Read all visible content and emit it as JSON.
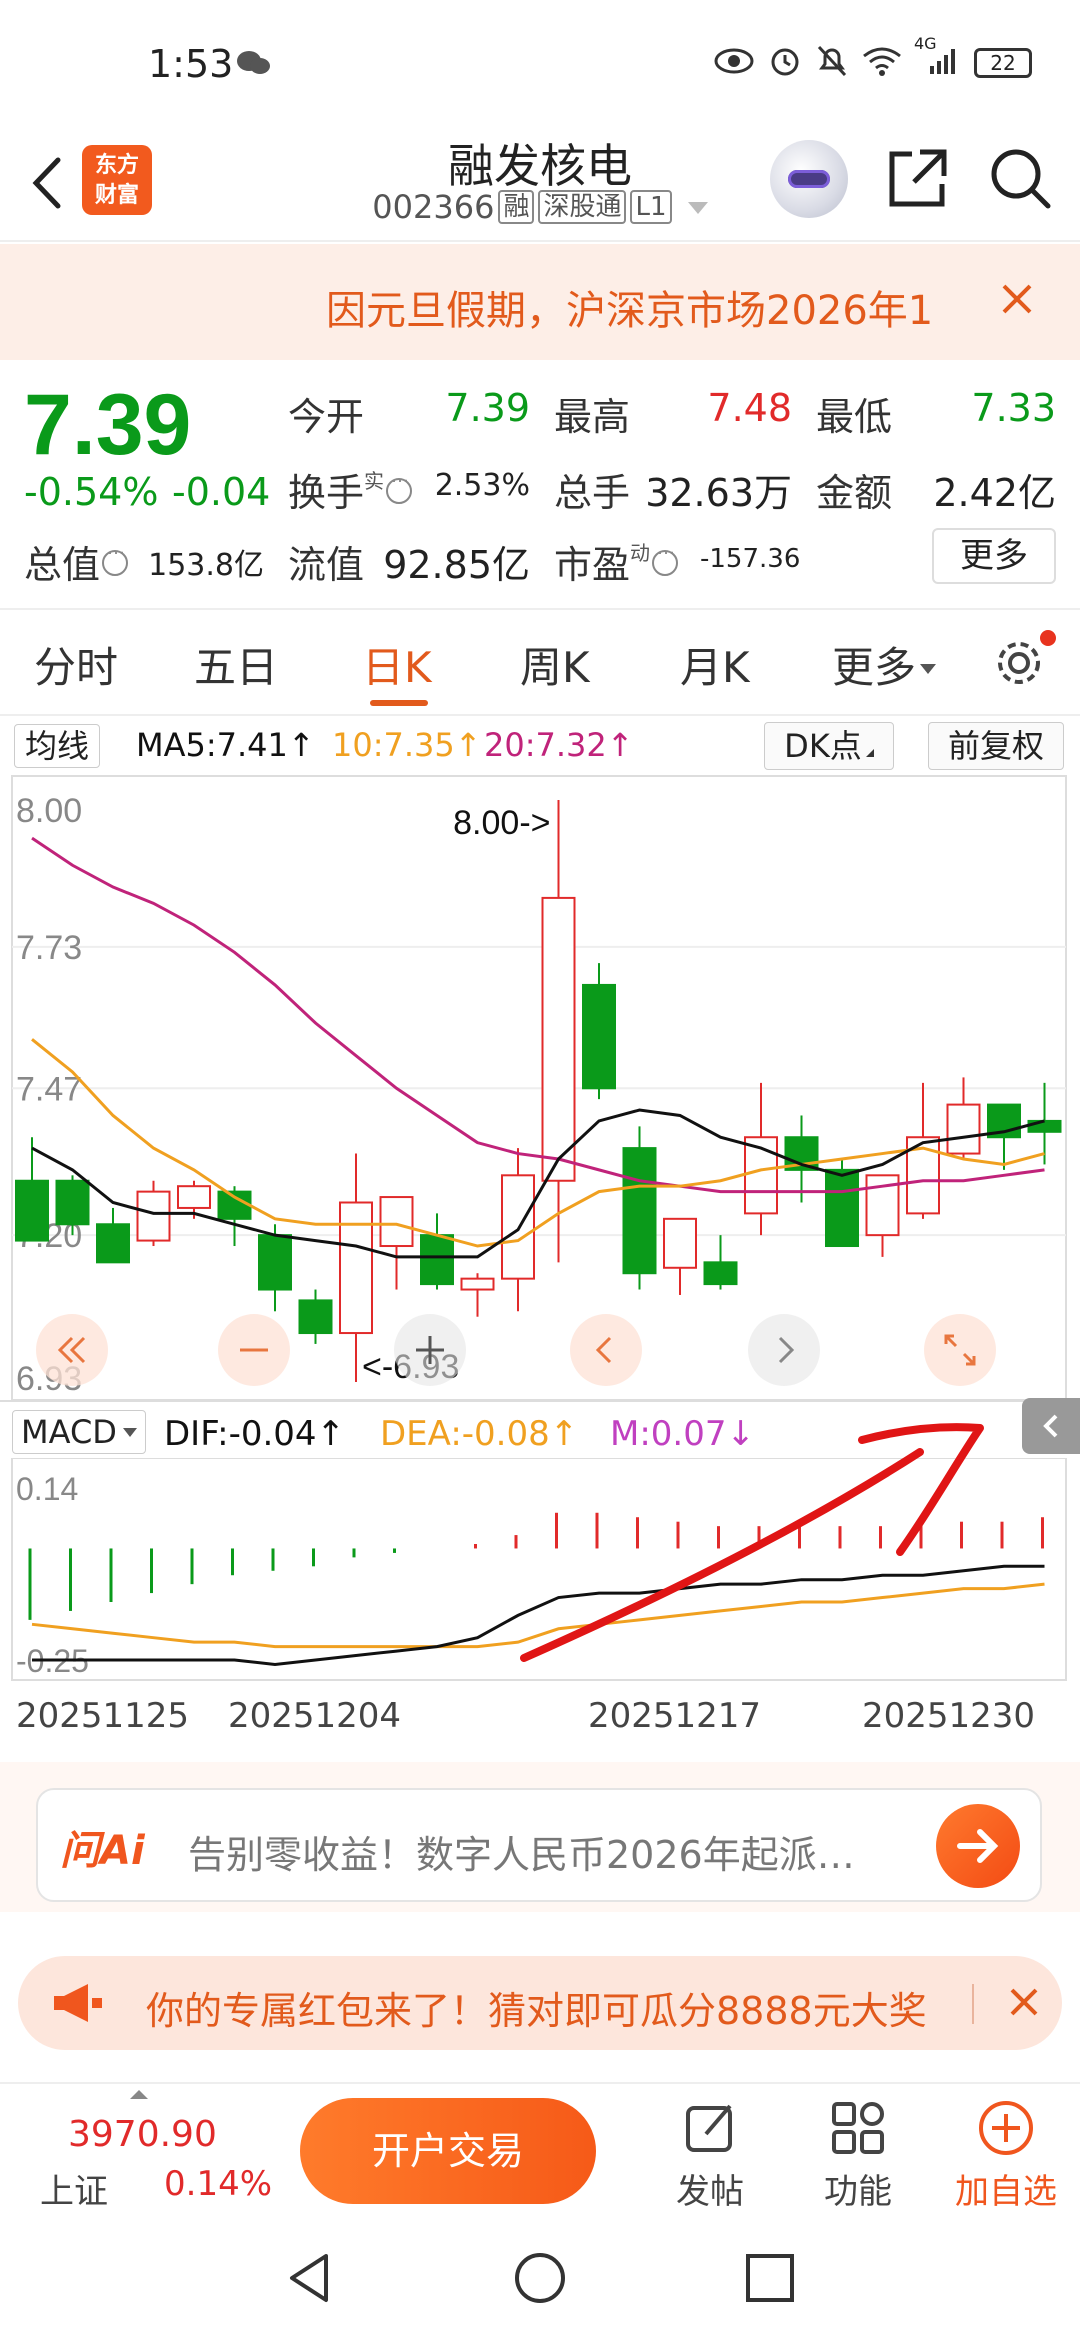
{
  "status_bar": {
    "time": "1:53",
    "network": "4G",
    "battery": "22"
  },
  "header": {
    "back_label": "back",
    "logo_text": [
      "东方",
      "财富"
    ],
    "stock_name": "融发核电",
    "stock_code": "002366",
    "tags": [
      "融",
      "深股通",
      "L1"
    ]
  },
  "notice": {
    "text": "因元旦假期，沪深京市场2026年1"
  },
  "quote": {
    "price": "7.39",
    "change_pct": "-0.54%",
    "change_abs": "-0.04",
    "open_label": "今开",
    "open_value": "7.39",
    "high_label": "最高",
    "high_value": "7.48",
    "low_label": "最低",
    "low_value": "7.33",
    "turnover_label": "换手",
    "turnover_sup": "实",
    "turnover_value": "2.53%",
    "volume_label": "总手",
    "volume_value": "32.63万",
    "amount_label": "金额",
    "amount_value": "2.42亿",
    "mcap_label": "总值",
    "mcap_value": "153.8亿",
    "float_label": "流值",
    "float_value": "92.85亿",
    "pe_label": "市盈",
    "pe_sup": "动",
    "pe_value": "-157.36",
    "more_label": "更多"
  },
  "tabs": [
    "分时",
    "五日",
    "日K",
    "周K",
    "月K",
    "更多"
  ],
  "active_tab": "日K",
  "ma_bar": {
    "type": "均线",
    "ma5": "MA5:7.41↑",
    "ma10": "10:7.35↑",
    "ma20": "20:7.32↑",
    "dk_label": "DK点",
    "adjust_label": "前复权"
  },
  "colors": {
    "up": "#e12a2a",
    "down": "#0a9a1a",
    "ma5": "#111111",
    "ma10": "#f0a020",
    "ma20": "#c0237a",
    "accent": "#e25a1c"
  },
  "chart_data": [
    {
      "type": "candlestick",
      "title": "日K",
      "y_ticks": [
        "8.00",
        "7.73",
        "7.47",
        "7.20",
        "6.93"
      ],
      "ylim": [
        6.93,
        8.0
      ],
      "max_label": "8.00->",
      "min_label": "<-6.93",
      "candles": [
        {
          "o": 7.3,
          "h": 7.38,
          "l": 7.2,
          "c": 7.19
        },
        {
          "o": 7.3,
          "h": 7.31,
          "l": 7.2,
          "c": 7.22
        },
        {
          "o": 7.22,
          "h": 7.25,
          "l": 7.15,
          "c": 7.15
        },
        {
          "o": 7.19,
          "h": 7.3,
          "l": 7.18,
          "c": 7.28
        },
        {
          "o": 7.25,
          "h": 7.3,
          "l": 7.23,
          "c": 7.29
        },
        {
          "o": 7.28,
          "h": 7.29,
          "l": 7.18,
          "c": 7.23
        },
        {
          "o": 7.2,
          "h": 7.22,
          "l": 7.06,
          "c": 7.1
        },
        {
          "o": 7.08,
          "h": 7.1,
          "l": 7.0,
          "c": 7.02
        },
        {
          "o": 7.02,
          "h": 7.35,
          "l": 6.93,
          "c": 7.26
        },
        {
          "o": 7.18,
          "h": 7.27,
          "l": 7.1,
          "c": 7.27
        },
        {
          "o": 7.2,
          "h": 7.24,
          "l": 7.1,
          "c": 7.11
        },
        {
          "o": 7.1,
          "h": 7.13,
          "l": 7.05,
          "c": 7.12
        },
        {
          "o": 7.12,
          "h": 7.36,
          "l": 7.06,
          "c": 7.31
        },
        {
          "o": 7.3,
          "h": 8.0,
          "l": 7.15,
          "c": 7.82
        },
        {
          "o": 7.66,
          "h": 7.7,
          "l": 7.45,
          "c": 7.47
        },
        {
          "o": 7.36,
          "h": 7.4,
          "l": 7.1,
          "c": 7.13
        },
        {
          "o": 7.14,
          "h": 7.22,
          "l": 7.09,
          "c": 7.23
        },
        {
          "o": 7.15,
          "h": 7.2,
          "l": 7.1,
          "c": 7.11
        },
        {
          "o": 7.24,
          "h": 7.48,
          "l": 7.2,
          "c": 7.38
        },
        {
          "o": 7.38,
          "h": 7.42,
          "l": 7.26,
          "c": 7.32
        },
        {
          "o": 7.32,
          "h": 7.34,
          "l": 7.18,
          "c": 7.18
        },
        {
          "o": 7.2,
          "h": 7.24,
          "l": 7.16,
          "c": 7.31
        },
        {
          "o": 7.24,
          "h": 7.48,
          "l": 7.23,
          "c": 7.38
        },
        {
          "o": 7.35,
          "h": 7.49,
          "l": 7.34,
          "c": 7.44
        },
        {
          "o": 7.44,
          "h": 7.44,
          "l": 7.32,
          "c": 7.38
        },
        {
          "o": 7.41,
          "h": 7.48,
          "l": 7.33,
          "c": 7.39
        }
      ],
      "ma5": [
        7.36,
        7.32,
        7.26,
        7.24,
        7.24,
        7.22,
        7.2,
        7.19,
        7.18,
        7.16,
        7.16,
        7.16,
        7.21,
        7.34,
        7.41,
        7.43,
        7.42,
        7.38,
        7.36,
        7.33,
        7.31,
        7.33,
        7.37,
        7.38,
        7.39,
        7.41
      ],
      "ma10": [
        7.56,
        7.5,
        7.42,
        7.36,
        7.32,
        7.27,
        7.23,
        7.22,
        7.22,
        7.22,
        7.2,
        7.18,
        7.19,
        7.24,
        7.28,
        7.29,
        7.29,
        7.3,
        7.32,
        7.33,
        7.34,
        7.35,
        7.36,
        7.34,
        7.33,
        7.35
      ],
      "ma20": [
        7.93,
        7.88,
        7.84,
        7.81,
        7.77,
        7.72,
        7.66,
        7.59,
        7.53,
        7.47,
        7.42,
        7.37,
        7.35,
        7.34,
        7.32,
        7.3,
        7.29,
        7.28,
        7.28,
        7.28,
        7.28,
        7.29,
        7.3,
        7.3,
        7.31,
        7.32
      ]
    },
    {
      "type": "bar",
      "title": "MACD",
      "y_ticks": [
        "0.14",
        "-0.25"
      ],
      "ylim": [
        -0.25,
        0.14
      ],
      "macd": [
        -0.16,
        -0.14,
        -0.12,
        -0.1,
        -0.08,
        -0.06,
        -0.05,
        -0.04,
        -0.02,
        -0.01,
        0.0,
        0.01,
        0.03,
        0.08,
        0.08,
        0.07,
        0.06,
        0.05,
        0.05,
        0.05,
        0.05,
        0.05,
        0.06,
        0.06,
        0.06,
        0.07
      ],
      "dif": [
        -0.25,
        -0.25,
        -0.25,
        -0.25,
        -0.25,
        -0.25,
        -0.26,
        -0.25,
        -0.24,
        -0.23,
        -0.22,
        -0.2,
        -0.15,
        -0.11,
        -0.1,
        -0.1,
        -0.09,
        -0.08,
        -0.08,
        -0.07,
        -0.07,
        -0.06,
        -0.06,
        -0.05,
        -0.04,
        -0.04
      ],
      "dea": [
        -0.17,
        -0.18,
        -0.19,
        -0.2,
        -0.21,
        -0.21,
        -0.22,
        -0.22,
        -0.22,
        -0.22,
        -0.22,
        -0.22,
        -0.21,
        -0.18,
        -0.17,
        -0.16,
        -0.15,
        -0.14,
        -0.13,
        -0.12,
        -0.12,
        -0.11,
        -0.1,
        -0.09,
        -0.09,
        -0.08
      ]
    }
  ],
  "nav_buttons": [
    "fast-back-icon",
    "zoom-out-icon",
    "zoom-in-icon",
    "prev-icon",
    "next-icon",
    "fullscreen-icon"
  ],
  "macd_bar": {
    "type": "MACD",
    "dif": "DIF:-0.04↑",
    "dea": "DEA:-0.08↑",
    "m": "M:0.07↓"
  },
  "dates": [
    "20251125",
    "20251204",
    "20251217",
    "20251230"
  ],
  "ai": {
    "logo": "问Ai",
    "prompt": "告别零收益！数字人民币2026年起派…"
  },
  "promo": {
    "text": "你的专属红包来了！猜对即可瓜分8888元大奖"
  },
  "bottom": {
    "index_value": "3970.90",
    "index_name": "上证",
    "index_change": "0.14%",
    "trade_label": "开户交易",
    "tools": [
      "发帖",
      "功能",
      "加自选"
    ]
  }
}
